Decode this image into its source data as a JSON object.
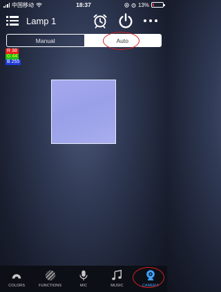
{
  "status_bar": {
    "carrier": "中国移动",
    "time": "18:37",
    "battery_percent": "13%",
    "battery_level": 0.13,
    "battery_color": "#e33333"
  },
  "header": {
    "title": "Lamp 1",
    "icons": [
      "menu-icon",
      "alarm-clock-icon",
      "power-icon",
      "more-dots-icon"
    ]
  },
  "mode_toggle": {
    "options": [
      "Manual",
      "Auto"
    ],
    "selected": "Auto"
  },
  "rgb": {
    "r_label": "R",
    "r_value": "38",
    "g_label": "G",
    "g_value": "44",
    "b_label": "B",
    "b_value": "255"
  },
  "swatch_color": "#9ea3ea",
  "bottom_nav": {
    "items": [
      {
        "label": "COLORS",
        "icon": "color-arc-icon"
      },
      {
        "label": "FUNCTIONS",
        "icon": "striped-ball-icon"
      },
      {
        "label": "MIC",
        "icon": "microphone-icon"
      },
      {
        "label": "MUSIC",
        "icon": "music-note-icon"
      },
      {
        "label": "CAMERA",
        "icon": "camera-icon"
      }
    ],
    "active": "CAMERA",
    "active_color": "#3fa3ff"
  },
  "annotation_color": "#d42020"
}
